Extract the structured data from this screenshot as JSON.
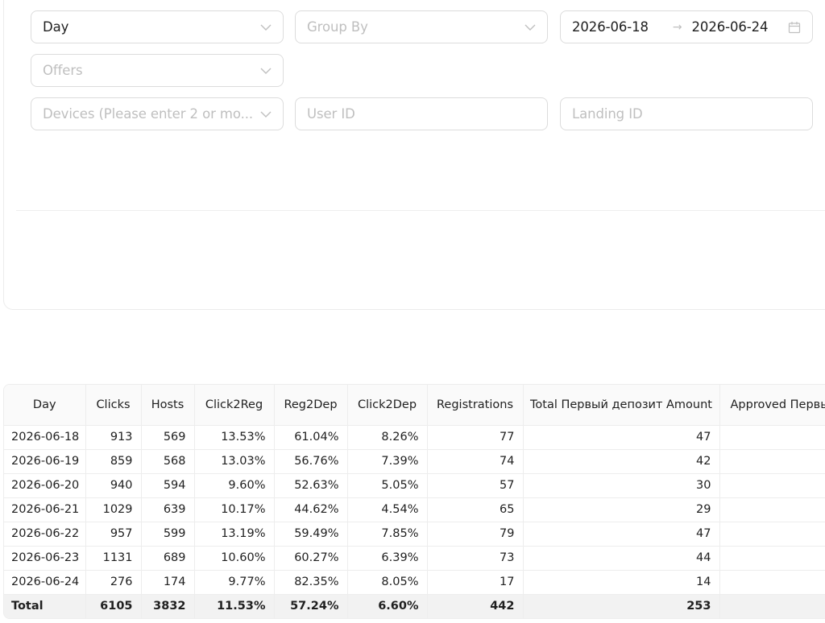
{
  "filters": {
    "period": {
      "value": "Day"
    },
    "group_by": {
      "placeholder": "Group By"
    },
    "date_range": {
      "start": "2026-06-18",
      "end": "2026-06-24",
      "arrow": "→"
    },
    "offers": {
      "placeholder": "Offers"
    },
    "devices": {
      "placeholder": "Devices (Please enter 2 or mo..."
    },
    "user_id": {
      "placeholder": "User ID"
    },
    "landing_id": {
      "placeholder": "Landing ID"
    }
  },
  "table": {
    "columns": [
      "Day",
      "Clicks",
      "Hosts",
      "Click2Reg",
      "Reg2Dep",
      "Click2Dep",
      "Registrations",
      "Total Первый депозит Amount",
      "Approved Первый депозит Amount"
    ],
    "rows": [
      [
        "2026-06-18",
        "913",
        "569",
        "13.53%",
        "61.04%",
        "8.26%",
        "77",
        "47",
        ""
      ],
      [
        "2026-06-19",
        "859",
        "568",
        "13.03%",
        "56.76%",
        "7.39%",
        "74",
        "42",
        ""
      ],
      [
        "2026-06-20",
        "940",
        "594",
        "9.60%",
        "52.63%",
        "5.05%",
        "57",
        "30",
        ""
      ],
      [
        "2026-06-21",
        "1029",
        "639",
        "10.17%",
        "44.62%",
        "4.54%",
        "65",
        "29",
        ""
      ],
      [
        "2026-06-22",
        "957",
        "599",
        "13.19%",
        "59.49%",
        "7.85%",
        "79",
        "47",
        ""
      ],
      [
        "2026-06-23",
        "1131",
        "689",
        "10.60%",
        "60.27%",
        "6.39%",
        "73",
        "44",
        ""
      ],
      [
        "2026-06-24",
        "276",
        "174",
        "9.77%",
        "82.35%",
        "8.05%",
        "17",
        "14",
        ""
      ]
    ],
    "total": [
      "Total",
      "6105",
      "3832",
      "11.53%",
      "57.24%",
      "6.60%",
      "442",
      "253",
      ""
    ]
  }
}
